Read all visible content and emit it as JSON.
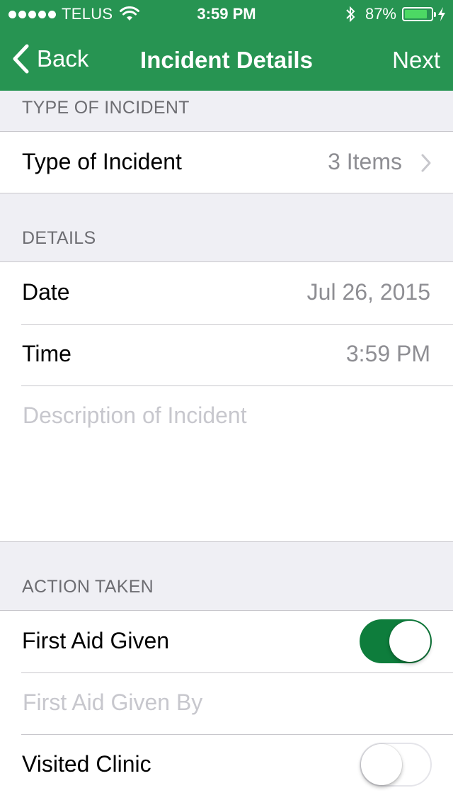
{
  "status_bar": {
    "carrier": "TELUS",
    "time": "3:59 PM",
    "battery_percent": "87%",
    "battery_level": 0.87,
    "icons": [
      "signal-dots-icon",
      "wifi-icon",
      "bluetooth-icon",
      "battery-icon",
      "charging-bolt-icon"
    ]
  },
  "nav": {
    "back_label": "Back",
    "title": "Incident Details",
    "next_label": "Next",
    "accent_color": "#279452"
  },
  "sections": {
    "type": {
      "header": "TYPE OF INCIDENT",
      "row_label": "Type of Incident",
      "row_value": "3 Items"
    },
    "details": {
      "header": "DETAILS",
      "date_label": "Date",
      "date_value": "Jul 26, 2015",
      "time_label": "Time",
      "time_value": "3:59 PM",
      "description_placeholder": "Description of Incident"
    },
    "action": {
      "header": "ACTION TAKEN",
      "first_aid_label": "First Aid Given",
      "first_aid_on": true,
      "first_aid_by_placeholder": "First Aid Given By",
      "visited_clinic_label": "Visited Clinic",
      "visited_clinic_on": false
    }
  }
}
